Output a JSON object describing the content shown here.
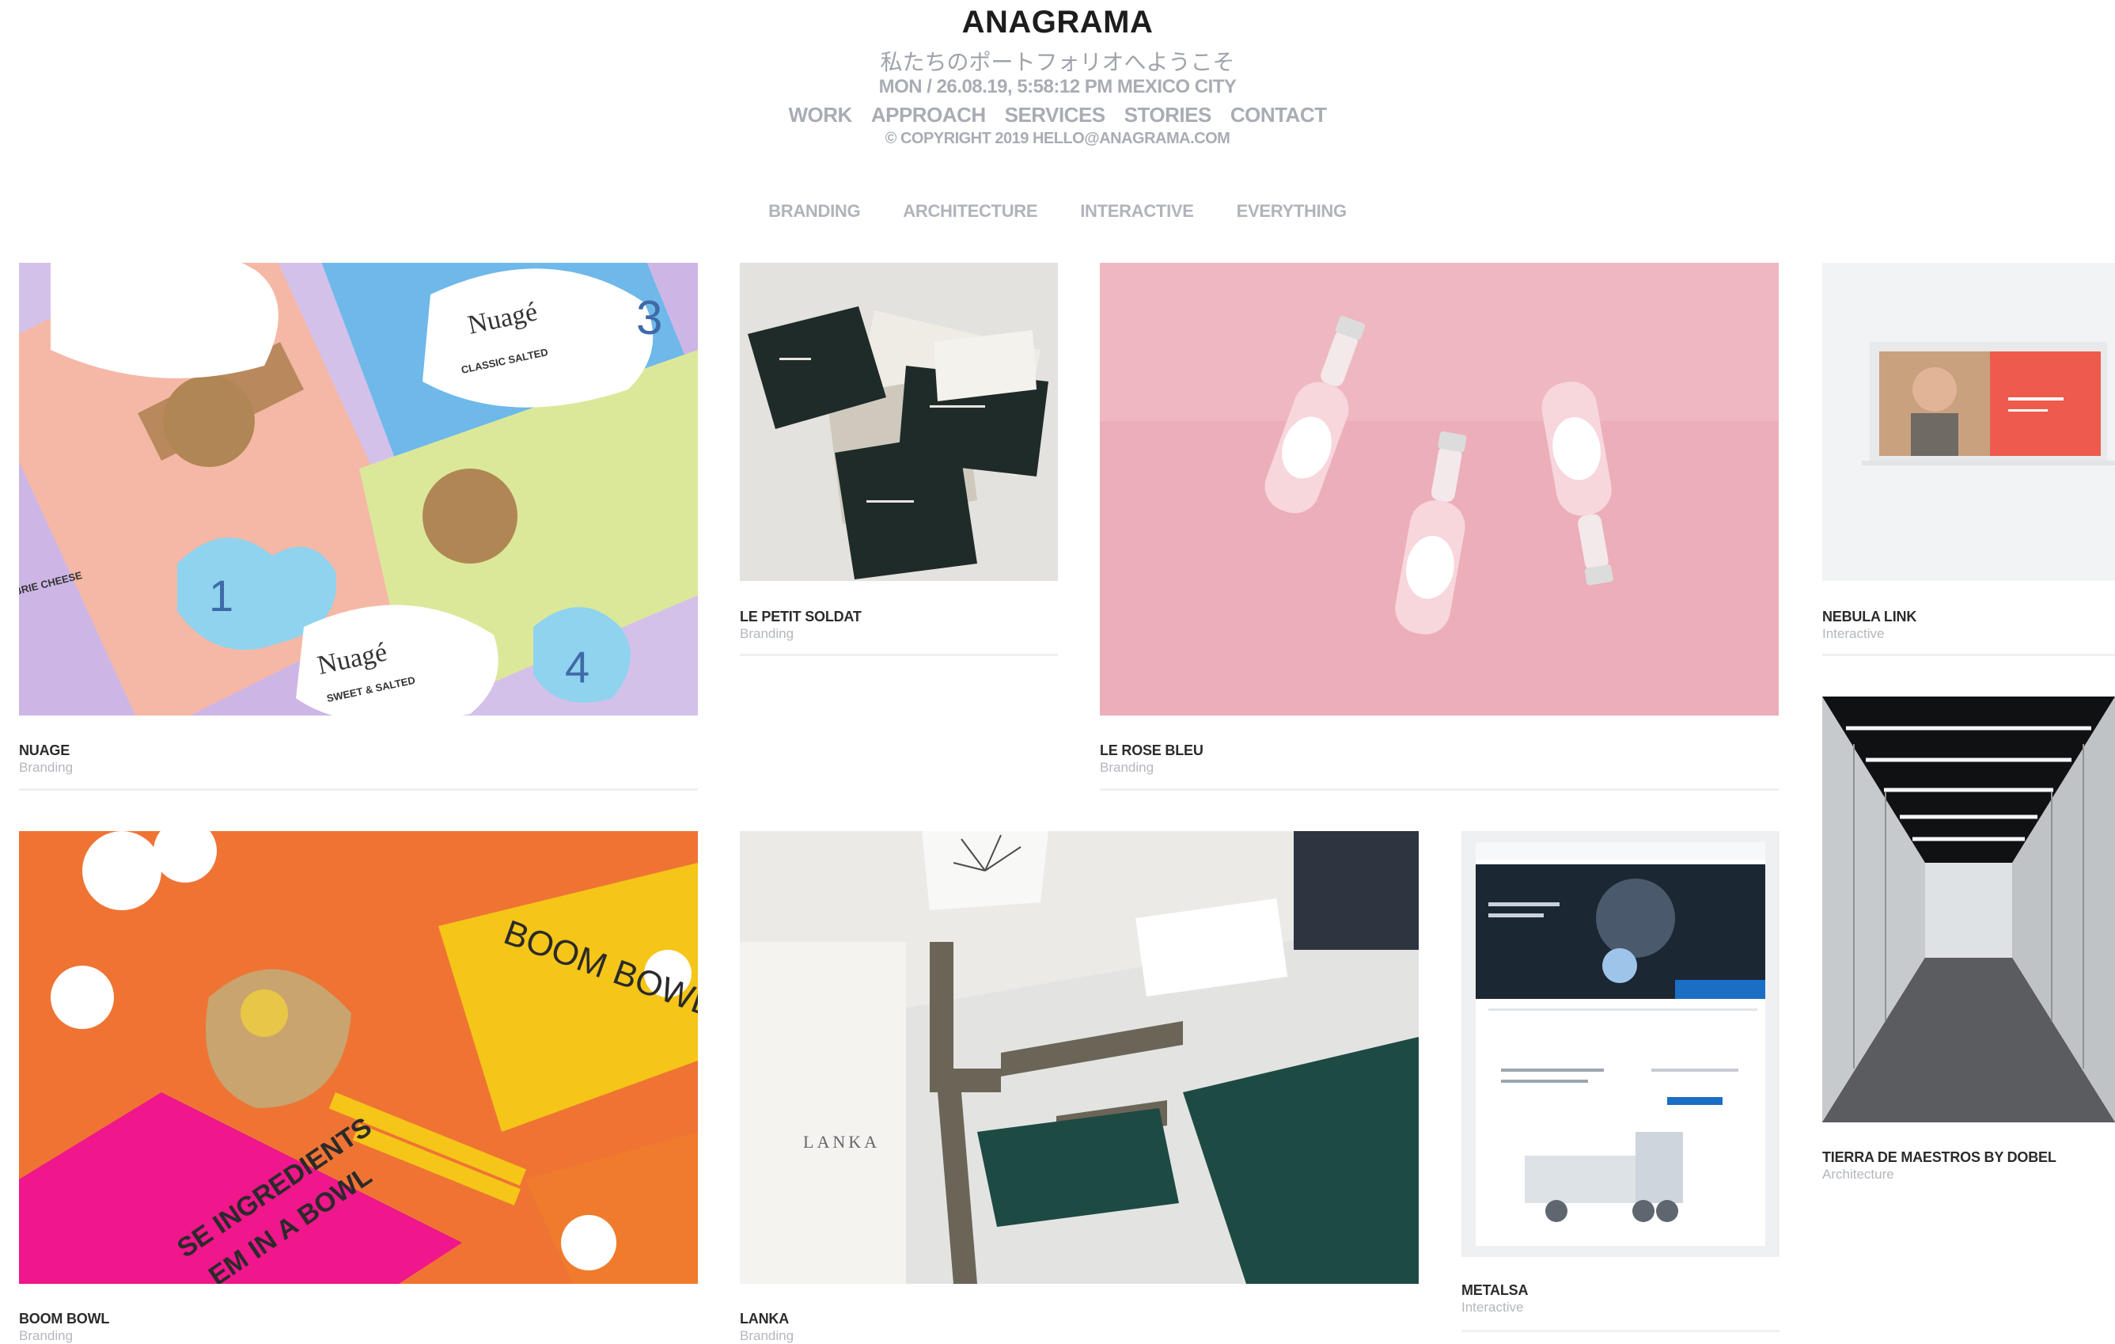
{
  "header": {
    "brand": "ANAGRAMA",
    "tagline": "私たちのポートフォリオへようこそ",
    "datetime": "MON / 26.08.19, 5:58:12 PM MEXICO CITY",
    "nav": [
      "WORK",
      "APPROACH",
      "SERVICES",
      "STORIES",
      "CONTACT"
    ],
    "copyright": "© COPYRIGHT 2019 HELLO@ANAGRAMA.COM"
  },
  "filters": [
    "BRANDING",
    "ARCHITECTURE",
    "INTERACTIVE",
    "EVERYTHING"
  ],
  "projects": [
    {
      "title": "NUAGE",
      "category": "Branding"
    },
    {
      "title": "LE PETIT SOLDAT",
      "category": "Branding"
    },
    {
      "title": "LE ROSE BLEU",
      "category": "Branding"
    },
    {
      "title": "NEBULA LINK",
      "category": "Interactive"
    },
    {
      "title": "TIERRA DE MAESTROS BY DOBEL",
      "category": "Architecture"
    },
    {
      "title": "BOOM BOWL",
      "category": "Branding"
    },
    {
      "title": "LANKA",
      "category": "Branding"
    },
    {
      "title": "METALSA",
      "category": "Interactive"
    }
  ],
  "image_text": {
    "nuage_brand": "Nuagé",
    "nuage_flavor_1": "CLASSIC SALTED",
    "nuage_flavor_2": "SWEET & SALTED",
    "nuage_flavor_3": "BRIE CHEESE",
    "nuage_num_1": "3",
    "nuage_num_2": "1",
    "nuage_num_3": "4",
    "boom_bowl": "BOOM BOWL",
    "boom_slogan": "SE INGREDIENTS",
    "boom_slogan_2": "EM IN A BOWL",
    "lanka": "LANKA"
  },
  "colors": {
    "accent_gray": "#a8adb4",
    "nebula_red": "#ee5a4c",
    "metalsa_blue": "#1a6fc4",
    "lanka_green": "#1e4a44",
    "boom_orange": "#ef7434",
    "boom_pink": "#f0168b",
    "boom_yellow": "#f5c518"
  }
}
